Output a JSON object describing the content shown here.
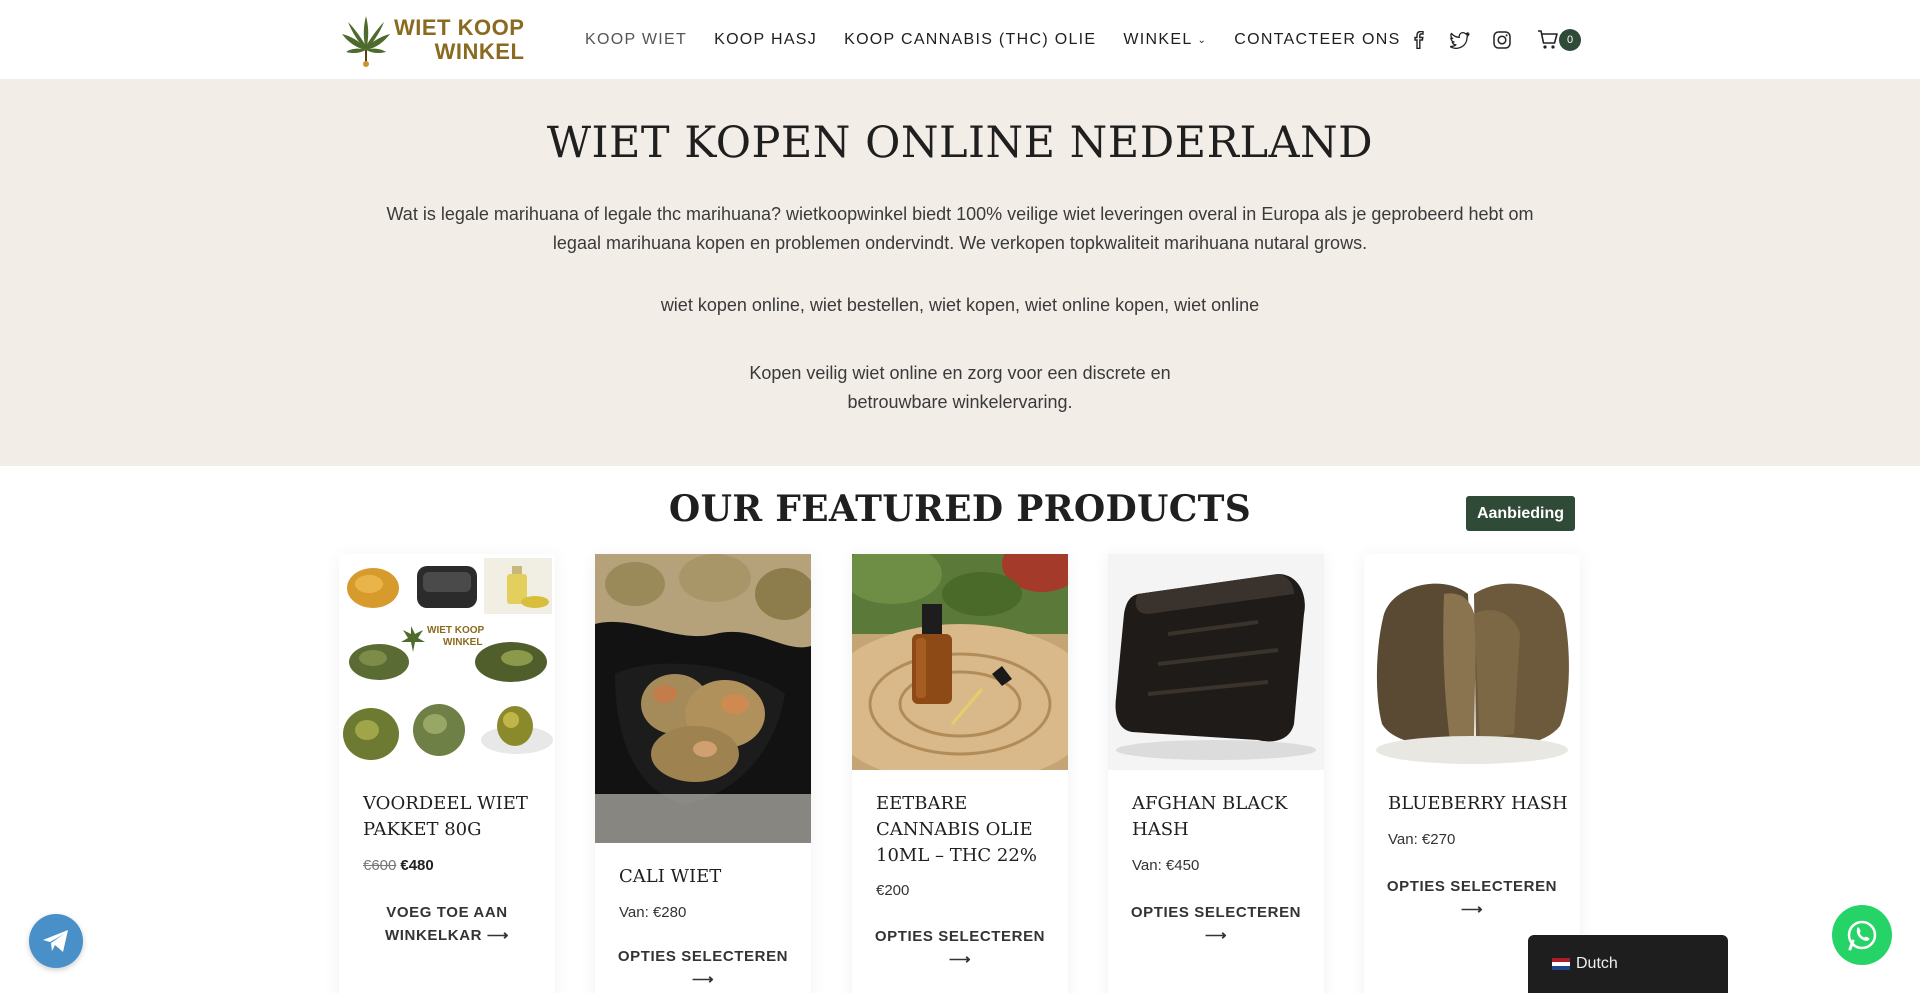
{
  "brand": {
    "logo_line1": "WIET KOOP",
    "logo_line2": "WINKEL"
  },
  "nav": {
    "items": [
      {
        "label": "KOOP WIET",
        "active": true
      },
      {
        "label": "KOOP HASJ",
        "active": false
      },
      {
        "label": "KOOP CANNABIS (THC) OLIE",
        "active": false
      },
      {
        "label": "WINKEL",
        "active": false,
        "dropdown": true
      },
      {
        "label": "CONTACTEER ONS",
        "active": false
      }
    ],
    "social_icons": [
      "facebook-icon",
      "twitter-icon",
      "instagram-icon"
    ],
    "cart_count": "0"
  },
  "hero": {
    "title": "WIET KOPEN ONLINE NEDERLAND",
    "paragraph1": "Wat is legale marihuana of legale thc marihuana? wietkoopwinkel biedt 100% veilige wiet leveringen overal in Europa als je geprobeerd hebt om legaal marihuana kopen en problemen ondervindt. We verkopen topkwaliteit marihuana nutaral grows.",
    "paragraph2": "wiet kopen online, wiet bestellen, wiet kopen, wiet online kopen, wiet online",
    "paragraph3": "Kopen veilig wiet online en zorg voor een discrete en betrouwbare winkelervaring."
  },
  "featured": {
    "title": "OUR FEATURED PRODUCTS",
    "sale_badge": "Aanbieding",
    "products": [
      {
        "title": "VOORDEEL WIET PAKKET 80G",
        "price_old": "€600",
        "price": "€480",
        "button": "VOEG TOE AAN WINKELKAR ⟶"
      },
      {
        "title": "CALI WIET",
        "price": "Van: €280",
        "button": "OPTIES SELECTEREN ⟶"
      },
      {
        "title": "EETBARE CANNABIS OLIE 10ML – THC 22%",
        "price": "€200",
        "button": "OPTIES SELECTEREN ⟶"
      },
      {
        "title": "AFGHAN BLACK HASH",
        "price": "Van: €450",
        "button": "OPTIES SELECTEREN ⟶"
      },
      {
        "title": "BLUEBERRY HASH",
        "price": "Van: €270",
        "button": "OPTIES SELECTEREN ⟶"
      }
    ]
  },
  "language_switcher": {
    "label": "Dutch"
  },
  "colors": {
    "accent": "#2f4a37",
    "hero_bg": "#f3ede8",
    "logo_gold": "#8a6a1e",
    "whatsapp": "#25d366",
    "telegram": "#4a90c8"
  }
}
